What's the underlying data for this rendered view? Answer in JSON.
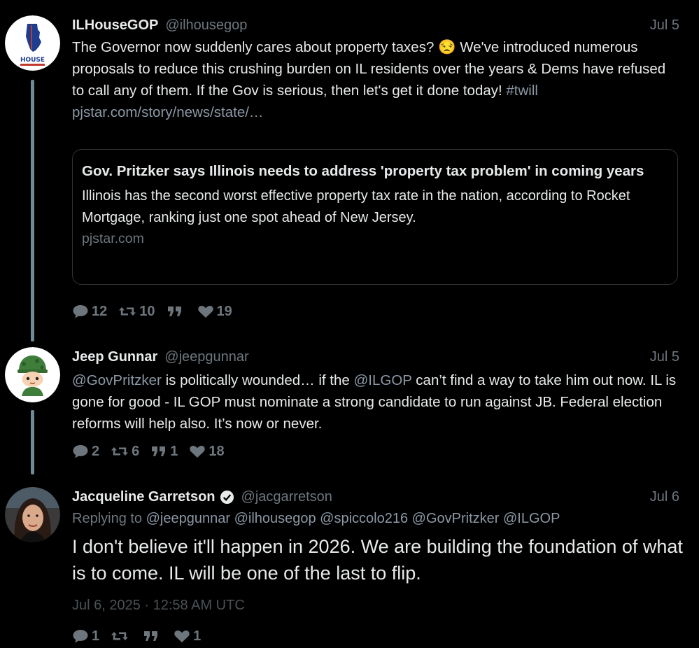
{
  "tweets": [
    {
      "display_name": "ILHouseGOP",
      "handle": "@ilhousegop",
      "date": "Jul 5",
      "text_before": "The Governor now suddenly cares about property taxes? ",
      "emoji": "😒",
      "text_after": " We've introduced numerous proposals to reduce this crushing burden on IL residents over the years & Dems have refused to call any of them. If the Gov is serious, then let's get it done today! ",
      "hashtag": "#twill",
      "link": "pjstar.com/story/news/state/…",
      "avatar_text": "HOUSE",
      "card": {
        "title": "Gov. Pritzker says Illinois needs to address 'property tax problem' in coming years",
        "description": "Illinois has the second worst effective property tax rate in the nation, according to Rocket Mortgage, ranking just one spot ahead of New Jersey.",
        "domain": "pjstar.com"
      },
      "stats": {
        "replies": "12",
        "retweets": "10",
        "quotes": "",
        "likes": "19"
      }
    },
    {
      "display_name": "Jeep Gunnar",
      "handle": "@jeepgunnar",
      "date": "Jul 5",
      "mention1": "@GovPritzker",
      "text_mid1": " is politically wounded… if the ",
      "mention2": "@ILGOP",
      "text_mid2": " can’t find a way to take him out now. IL is gone for good - IL GOP must nominate a strong candidate to run against JB. Federal election reforms will help also. It’s now or never.",
      "stats": {
        "replies": "2",
        "retweets": "6",
        "quotes": "1",
        "likes": "18"
      }
    },
    {
      "display_name": "Jacqueline Garretson",
      "handle": "@jacgarretson",
      "date": "Jul 6",
      "replying_label": "Replying to",
      "replying_to": "@jeepgunnar @ilhousegop @spiccolo216 @GovPritzker @ILGOP",
      "text": "I don't believe it'll happen in 2026. We are building the foundation of what is to come. IL will be one of the last to flip.",
      "timestamp": "Jul 6, 2025 · 12:58 AM UTC",
      "stats": {
        "replies": "1",
        "retweets": "",
        "quotes": "",
        "likes": "1"
      }
    }
  ],
  "colors": {
    "background": "#000000",
    "text": "#e7e9ea",
    "muted": "#6e767d",
    "link": "#8b98a5",
    "thread_line": "#6f8b95",
    "verified": "#e7e9ea"
  },
  "icons": [
    "reply-icon",
    "retweet-icon",
    "quote-icon",
    "like-icon",
    "verified-badge-icon"
  ]
}
